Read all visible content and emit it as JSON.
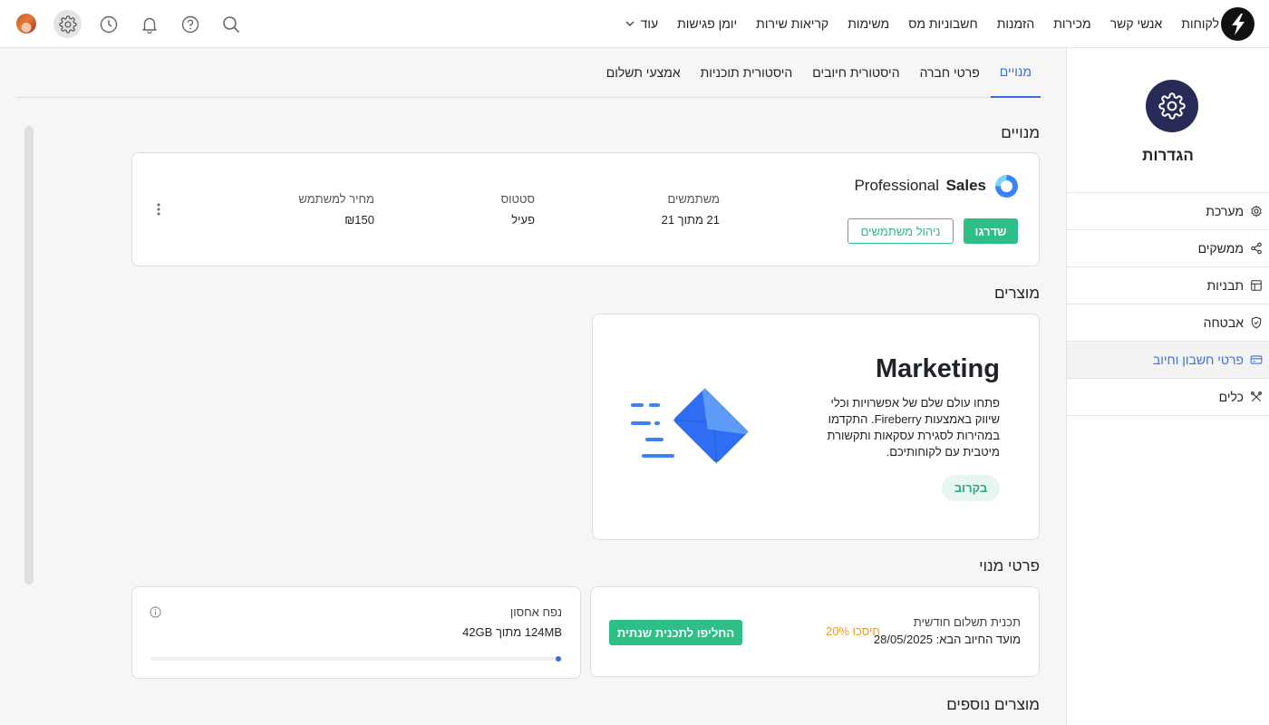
{
  "nav": {
    "items": [
      "לקוחות",
      "אנשי קשר",
      "מכירות",
      "הזמנות",
      "חשבוניות מס",
      "משימות",
      "קריאות שירות",
      "יומן פגישות"
    ],
    "more_label": "עוד"
  },
  "sidebar": {
    "title": "הגדרות",
    "items": [
      {
        "label": "מערכת",
        "icon": "gear-icon"
      },
      {
        "label": "ממשקים",
        "icon": "share-icon"
      },
      {
        "label": "תבניות",
        "icon": "layout-icon"
      },
      {
        "label": "אבטחה",
        "icon": "shield-icon"
      },
      {
        "label": "פרטי חשבון וחיוב",
        "icon": "credit-card-icon",
        "active": true
      },
      {
        "label": "כלים",
        "icon": "tools-icon"
      }
    ]
  },
  "tabs": [
    "מנויים",
    "פרטי חברה",
    "היסטורית חיובים",
    "היסטורית תוכניות",
    "אמצעי תשלום"
  ],
  "sections": {
    "subscriptions": "מנויים",
    "products": "מוצרים",
    "plan_details": "פרטי מנוי",
    "more_products": "מוצרים נוספים"
  },
  "subscription": {
    "product": "Sales",
    "plan": "Professional",
    "upgrade_label": "שדרגו",
    "manage_users_label": "ניהול משתמשים",
    "users_label": "משתמשים",
    "users_value": "21 מתוך 21",
    "status_label": "סטטוס",
    "status_value": "פעיל",
    "price_label": "מחיר למשתמש",
    "price_value": "₪150"
  },
  "marketing": {
    "title": "Marketing",
    "description": "פתחו עולם שלם של אפשרויות וכלי שיווק באמצעות Fireberry. התקדמו במהירות לסגירת עסקאות ותקשורת מיטבית עם לקוחותיכם.",
    "badge": "בקרוב"
  },
  "plan": {
    "type_label": "תכנית תשלום חודשית",
    "next_billing": "מועד החיוב הבא: 28/05/2025",
    "save_label": "חיסכו 20%",
    "switch_label": "החליפו לתכנית שנתית"
  },
  "storage": {
    "label": "נפח אחסון",
    "value": "124MB מתוך 42GB",
    "used_fraction": 0.003
  },
  "colors": {
    "accent": "#3b6fe0",
    "green": "#2dbf86",
    "orange": "#f29b1a",
    "brand_dark": "#272b57"
  }
}
